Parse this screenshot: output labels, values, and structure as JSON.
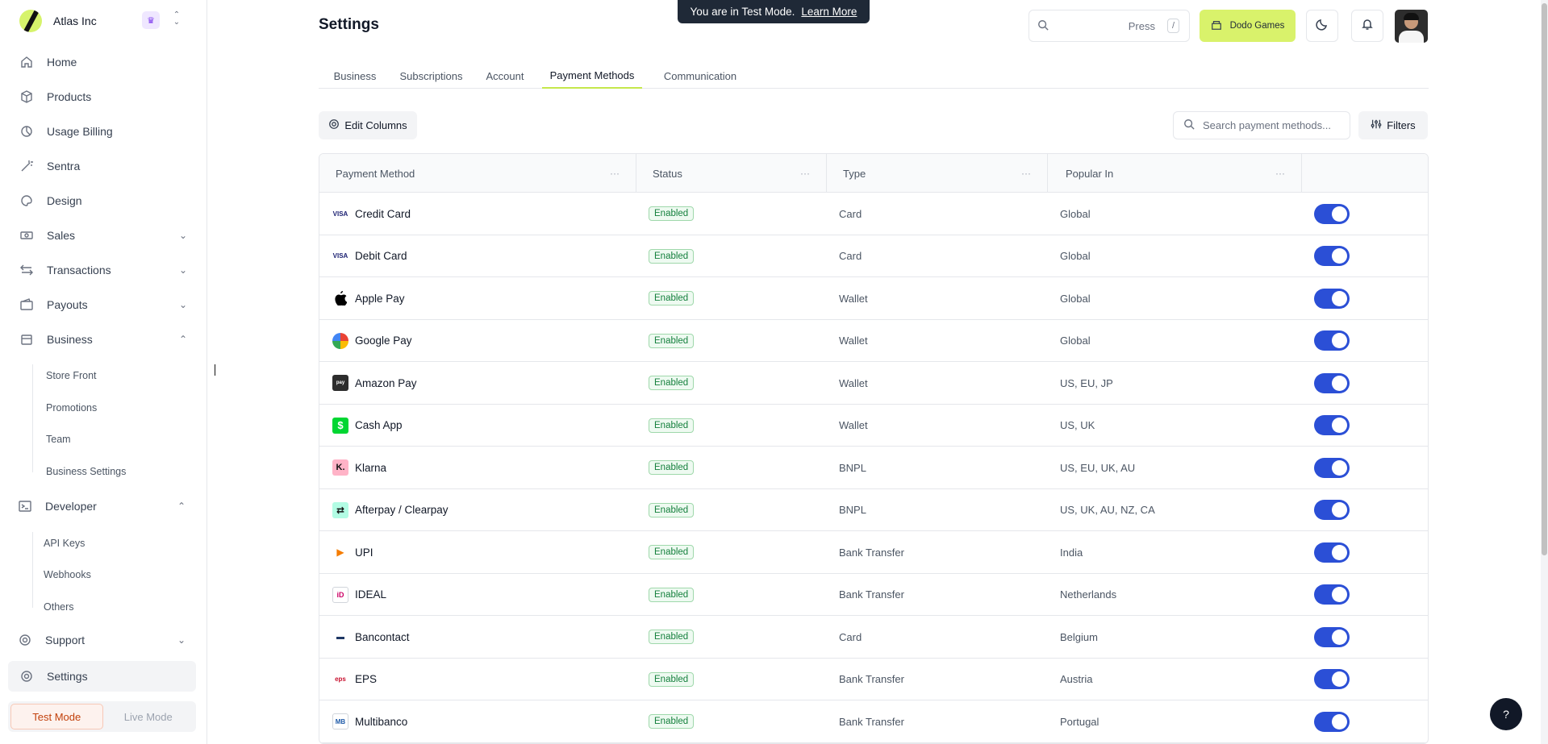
{
  "org": {
    "name": "Atlas Inc"
  },
  "banner": {
    "text": "You are in Test Mode.",
    "link": "Learn More"
  },
  "header": {
    "title": "Settings",
    "search_hint": "Press",
    "search_key": "/",
    "brand_button": "Dodo Games"
  },
  "nav": {
    "home": "Home",
    "products": "Products",
    "usage_billing": "Usage Billing",
    "sentra": "Sentra",
    "design": "Design",
    "sales": "Sales",
    "transactions": "Transactions",
    "payouts": "Payouts",
    "business": "Business",
    "business_sub": [
      "Store Front",
      "Promotions",
      "Team",
      "Business Settings"
    ],
    "developer": "Developer",
    "developer_sub": [
      "API Keys",
      "Webhooks",
      "Others"
    ],
    "support": "Support",
    "settings": "Settings"
  },
  "mode": {
    "test": "Test Mode",
    "live": "Live Mode"
  },
  "tabs": [
    "Business",
    "Subscriptions",
    "Account",
    "Payment Methods",
    "Communication"
  ],
  "toolbar": {
    "edit_columns": "Edit Columns",
    "search_placeholder": "Search payment methods...",
    "filters": "Filters"
  },
  "table": {
    "columns": [
      "Payment Method",
      "Status",
      "Type",
      "Popular In"
    ],
    "rows": [
      {
        "method": "Credit Card",
        "status": "Enabled",
        "type": "Card",
        "popular": "Global",
        "icon": "visa-icon"
      },
      {
        "method": "Debit Card",
        "status": "Enabled",
        "type": "Card",
        "popular": "Global",
        "icon": "visa-icon"
      },
      {
        "method": "Apple Pay",
        "status": "Enabled",
        "type": "Wallet",
        "popular": "Global",
        "icon": "apple-icon"
      },
      {
        "method": "Google Pay",
        "status": "Enabled",
        "type": "Wallet",
        "popular": "Global",
        "icon": "google-icon"
      },
      {
        "method": "Amazon Pay",
        "status": "Enabled",
        "type": "Wallet",
        "popular": "US, EU, JP",
        "icon": "amazon-icon"
      },
      {
        "method": "Cash App",
        "status": "Enabled",
        "type": "Wallet",
        "popular": "US, UK",
        "icon": "cashapp-icon"
      },
      {
        "method": "Klarna",
        "status": "Enabled",
        "type": "BNPL",
        "popular": "US, EU, UK, AU",
        "icon": "klarna-icon"
      },
      {
        "method": "Afterpay / Clearpay",
        "status": "Enabled",
        "type": "BNPL",
        "popular": "US, UK, AU, NZ, CA",
        "icon": "afterpay-icon"
      },
      {
        "method": "UPI",
        "status": "Enabled",
        "type": "Bank Transfer",
        "popular": "India",
        "icon": "upi-icon"
      },
      {
        "method": "IDEAL",
        "status": "Enabled",
        "type": "Bank Transfer",
        "popular": "Netherlands",
        "icon": "ideal-icon"
      },
      {
        "method": "Bancontact",
        "status": "Enabled",
        "type": "Card",
        "popular": "Belgium",
        "icon": "bancontact-icon"
      },
      {
        "method": "EPS",
        "status": "Enabled",
        "type": "Bank Transfer",
        "popular": "Austria",
        "icon": "eps-icon"
      },
      {
        "method": "Multibanco",
        "status": "Enabled",
        "type": "Bank Transfer",
        "popular": "Portugal",
        "icon": "multibanco-icon"
      }
    ]
  },
  "help": {
    "label": "?"
  },
  "colors": {
    "accent": "#c5e84b",
    "toggle": "#2b4fd6",
    "badge": "#15803d"
  }
}
